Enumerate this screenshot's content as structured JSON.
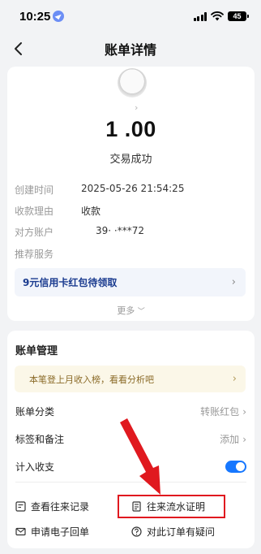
{
  "status_bar": {
    "time": "10:25",
    "battery": "45"
  },
  "nav": {
    "title": "账单详情"
  },
  "transaction": {
    "amount": "1   .00",
    "status": "交易成功",
    "details": [
      {
        "label": "创建时间",
        "value": "2025-05-26 21:54:25"
      },
      {
        "label": "收款理由",
        "value": "收款"
      },
      {
        "label": "对方账户",
        "value": "39· ·***72"
      },
      {
        "label": "推荐服务",
        "value": ""
      }
    ],
    "promo": "9元信用卡红包待领取",
    "more": "更多"
  },
  "management": {
    "title": "账单管理",
    "tip": "本笔登上月收入榜，看看分析吧",
    "rows": [
      {
        "label": "账单分类",
        "value": "转账红包"
      },
      {
        "label": "标签和备注",
        "value": "添加"
      },
      {
        "label": "计入收支",
        "value": ""
      }
    ],
    "toggle_on": true,
    "actions": [
      {
        "label": "查看往来记录",
        "icon": "history-icon"
      },
      {
        "label": "往来流水证明",
        "icon": "statement-icon"
      },
      {
        "label": "申请电子回单",
        "icon": "mail-icon"
      },
      {
        "label": "对此订单有疑问",
        "icon": "question-icon"
      }
    ]
  },
  "colors": {
    "accent": "#1677ff",
    "annotation": "#e0191f",
    "promo_text": "#1a3b8f",
    "tip_text": "#8a6a27"
  }
}
